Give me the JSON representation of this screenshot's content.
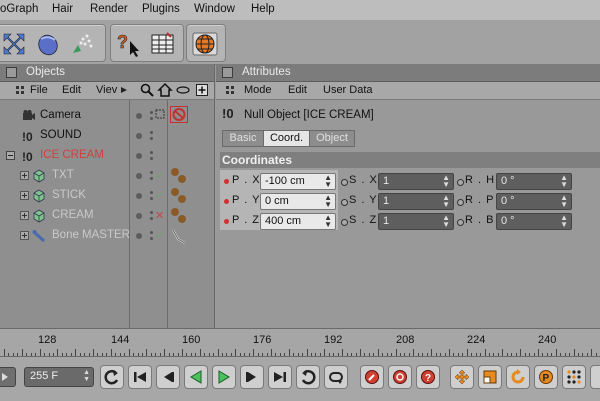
{
  "menu": [
    "oGraph",
    "Hair",
    "Render",
    "Plugins",
    "Window",
    "Help"
  ],
  "objects_panel": {
    "title": "Objects",
    "menu": [
      "File",
      "Edit",
      "Viev"
    ],
    "items": [
      {
        "name": "Camera",
        "color": "#111111",
        "icon": "camera-icon"
      },
      {
        "name": "SOUND",
        "color": "#111111",
        "icon": "null-icon"
      },
      {
        "name": "ICE CREAM",
        "color": "#d04040",
        "icon": "null-icon"
      },
      {
        "name": "TXT",
        "color": "#c9c9c9",
        "icon": "cube-icon"
      },
      {
        "name": "STICK",
        "color": "#c9c9c9",
        "icon": "cube-icon"
      },
      {
        "name": "CREAM",
        "color": "#c9c9c9",
        "icon": "cube-icon"
      },
      {
        "name": "Bone MASTER",
        "color": "#c9c9c9",
        "icon": "bone-icon"
      }
    ]
  },
  "attributes_panel": {
    "title": "Attributes",
    "menu": [
      "Mode",
      "Edit",
      "User Data"
    ],
    "object_label": "Null Object [ICE CREAM]",
    "tabs": [
      "Basic",
      "Coord.",
      "Object"
    ],
    "active_tab": "Coord.",
    "section": "Coordinates",
    "rows": [
      {
        "p_label": "P . X",
        "p_value": "-100 cm",
        "s_label": "S . X",
        "s_value": "1",
        "r_label": "R . H",
        "r_value": "0 °"
      },
      {
        "p_label": "P . Y",
        "p_value": "0 cm",
        "s_label": "S . Y",
        "s_value": "1",
        "r_label": "R . P",
        "r_value": "0 °"
      },
      {
        "p_label": "P . Z",
        "p_value": "400 cm",
        "s_label": "S . Z",
        "s_value": "1",
        "r_label": "R . B",
        "r_value": "0 °"
      }
    ]
  },
  "timeline": {
    "labels": [
      "128",
      "144",
      "160",
      "176",
      "192",
      "208",
      "224",
      "240"
    ]
  },
  "transport": {
    "frame_value": "255 F"
  },
  "colors": {
    "accent_red": "#d23030",
    "check_green": "#6aa56a"
  }
}
